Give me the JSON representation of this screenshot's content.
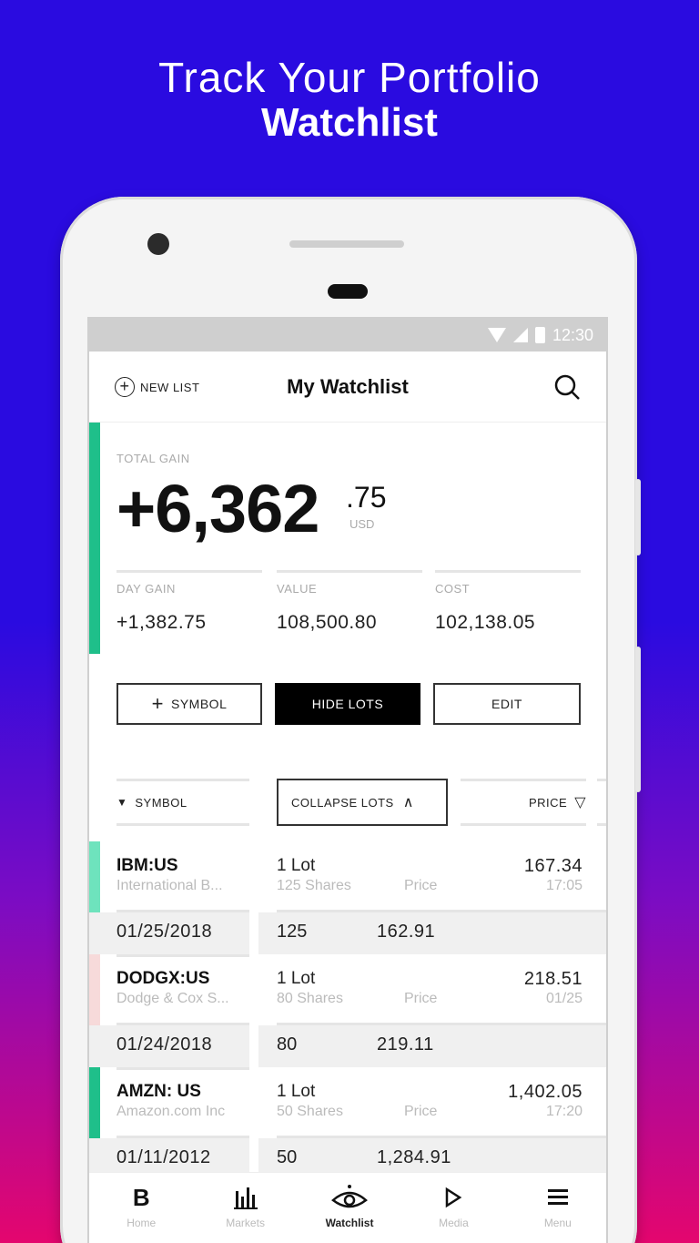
{
  "promo": {
    "line1": "Track Your Portfolio",
    "line2": "Watchlist"
  },
  "status_bar": {
    "time": "12:30"
  },
  "appbar": {
    "new_list": "NEW LIST",
    "title": "My Watchlist",
    "search_icon": "search-icon"
  },
  "summary": {
    "total_label": "TOTAL GAIN",
    "total_whole": "+6,362",
    "total_cents": ".75",
    "currency": "USD",
    "stats": [
      {
        "label": "DAY GAIN",
        "value": "+1,382.75"
      },
      {
        "label": "VALUE",
        "value": "108,500.80"
      },
      {
        "label": "COST",
        "value": "102,138.05"
      }
    ],
    "accent_color": "#1fbf8a"
  },
  "buttons": {
    "symbol": "SYMBOL",
    "hide_lots": "HIDE LOTS",
    "edit": "EDIT"
  },
  "columns": {
    "symbol": "SYMBOL",
    "collapse": "COLLAPSE LOTS",
    "price": "PRICE"
  },
  "holdings": [
    {
      "symbol": "IBM:US",
      "name": "International B...",
      "lots": "1 Lot",
      "shares": "125 Shares",
      "price_label": "Price",
      "price": "167.34",
      "sub": "17:05",
      "lot_date": "01/25/2018",
      "lot_shares": "125",
      "lot_price": "162.91",
      "stripe_color": "#6ee3bd"
    },
    {
      "symbol": "DODGX:US",
      "name": "Dodge & Cox S...",
      "lots": "1 Lot",
      "shares": "80 Shares",
      "price_label": "Price",
      "price": "218.51",
      "sub": "01/25",
      "lot_date": "01/24/2018",
      "lot_shares": "80",
      "lot_price": "219.11",
      "stripe_color": "#f7dada"
    },
    {
      "symbol": "AMZN: US",
      "name": "Amazon.com Inc",
      "lots": "1 Lot",
      "shares": "50 Shares",
      "price_label": "Price",
      "price": "1,402.05",
      "sub": "17:20",
      "lot_date": "01/11/2012",
      "lot_shares": "50",
      "lot_price": "1,284.91",
      "stripe_color": "#1fbf8a"
    }
  ],
  "nav": [
    {
      "label": "Home",
      "icon": "B"
    },
    {
      "label": "Markets",
      "icon": "bar-chart-icon"
    },
    {
      "label": "Watchlist",
      "icon": "eye-icon"
    },
    {
      "label": "Media",
      "icon": "play-icon"
    },
    {
      "label": "Menu",
      "icon": "menu-icon"
    }
  ]
}
